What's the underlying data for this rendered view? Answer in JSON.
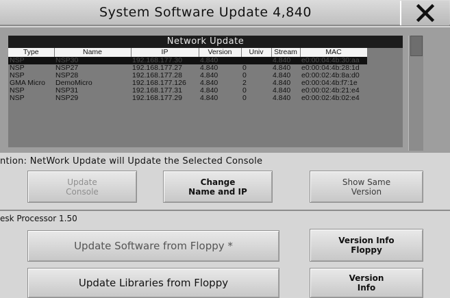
{
  "window": {
    "title": "System Software Update 4,840"
  },
  "network": {
    "title": "Network Update",
    "columns": [
      "Type",
      "Name",
      "IP",
      "Version",
      "Univ",
      "Stream",
      "MAC"
    ],
    "rows": [
      [
        "NSP",
        "NSP30",
        "192.168.177.30",
        "4.840",
        "",
        "4.840",
        "e0:00:04:4b:30:aa"
      ],
      [
        "NSP",
        "NSP27",
        "192.168.177.27",
        "4.840",
        "0",
        "4.840",
        "e0:00:04:4b:28:1d"
      ],
      [
        "NSP",
        "NSP28",
        "192.168.177.28",
        "4.840",
        "0",
        "4.840",
        "e0:00:02:4b:8a:d0"
      ],
      [
        "GMA Micro",
        "DemoMicro",
        "192.168.177.126",
        "4.840",
        "2",
        "4.840",
        "e0:00:04:4b:f7:1e"
      ],
      [
        "NSP",
        "NSP31",
        "192.168.177.31",
        "4.840",
        "0",
        "4.840",
        "e0:00:02:4b:21:e4"
      ],
      [
        "NSP",
        "NSP29",
        "192.168.177.29",
        "4.840",
        "0",
        "4.840",
        "e0:00:02:4b:02:e4"
      ]
    ]
  },
  "notice": "ntion: NetWork Update will Update the Selected Console",
  "buttons": {
    "update_console": [
      "Update",
      "Console"
    ],
    "change_name": [
      "Change",
      "Name and IP"
    ],
    "show_same": [
      "Show Same",
      "Version"
    ],
    "update_software_floppy": "Update Software from Floppy *",
    "version_info_floppy": [
      "Version Info",
      "Floppy"
    ],
    "update_libraries_floppy": "Update Libraries from Floppy",
    "version_info": [
      "Version",
      "Info"
    ]
  },
  "desk_processor": "esk Processor 1.50",
  "icons": {
    "close": "close-icon"
  },
  "colors": {
    "selected_row": "#111111",
    "header": "#1c1c1c",
    "panel": "#9e9e9e"
  }
}
